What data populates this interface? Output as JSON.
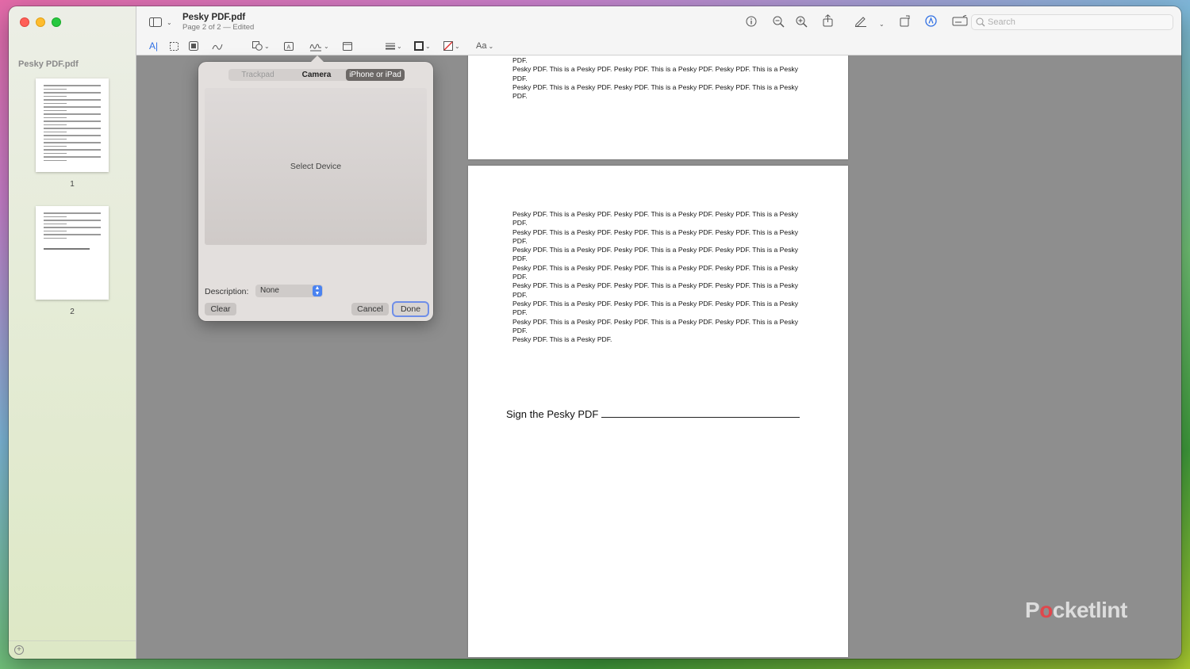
{
  "window": {
    "title": "Pesky PDF.pdf",
    "subtitle": "Page 2 of 2 — Edited"
  },
  "sidebar": {
    "title": "Pesky PDF.pdf",
    "pages": [
      {
        "label": "1"
      },
      {
        "label": "2"
      }
    ]
  },
  "toolbar": {
    "search_placeholder": "Search",
    "icons": [
      "sidebar-toggle-icon",
      "info-icon",
      "zoom-out-icon",
      "zoom-in-icon",
      "share-icon",
      "pen-icon",
      "rotate-icon",
      "markup-icon",
      "form-fill-icon"
    ],
    "markup_icons": [
      "text-select-icon",
      "rect-select-icon",
      "redact-icon",
      "sketch-icon",
      "shapes-icon",
      "text-box-icon",
      "signature-icon",
      "note-icon",
      "line-style-icon",
      "border-color-icon",
      "fill-color-icon"
    ],
    "font_label": "Aa"
  },
  "document": {
    "page1_lines": [
      "PDF.",
      "Pesky PDF. This is a Pesky PDF. Pesky PDF. This is a Pesky PDF. Pesky PDF. This is a Pesky",
      "PDF.",
      "Pesky PDF. This is a Pesky PDF. Pesky PDF. This is a Pesky PDF. Pesky PDF. This is a Pesky",
      "PDF."
    ],
    "page2_lines": [
      "Pesky PDF. This is a Pesky PDF. Pesky PDF. This is a Pesky PDF. Pesky PDF. This is a Pesky",
      "PDF.",
      "Pesky PDF. This is a Pesky PDF. Pesky PDF. This is a Pesky PDF. Pesky PDF. This is a Pesky",
      "PDF.",
      "Pesky PDF. This is a Pesky PDF. Pesky PDF. This is a Pesky PDF. Pesky PDF. This is a Pesky",
      "PDF.",
      "Pesky PDF. This is a Pesky PDF. Pesky PDF. This is a Pesky PDF. Pesky PDF. This is a Pesky",
      "PDF.",
      "Pesky PDF. This is a Pesky PDF. Pesky PDF. This is a Pesky PDF. Pesky PDF. This is a Pesky",
      "PDF.",
      "Pesky PDF. This is a Pesky PDF. Pesky PDF. This is a Pesky PDF. Pesky PDF. This is a Pesky",
      "PDF.",
      "Pesky PDF. This is a Pesky PDF. Pesky PDF. This is a Pesky PDF. Pesky PDF. This is a Pesky",
      "PDF.",
      "Pesky PDF. This is a Pesky PDF."
    ],
    "signature_prompt": "Sign the Pesky PDF"
  },
  "signature_popover": {
    "tabs": [
      "Trackpad",
      "Camera",
      "iPhone or iPad"
    ],
    "active_tab": "iPhone or iPad",
    "area_text": "Select Device",
    "description_label": "Description:",
    "description_value": "None",
    "clear_label": "Clear",
    "cancel_label": "Cancel",
    "done_label": "Done"
  },
  "watermark": {
    "text_before": "P",
    "text_o": "o",
    "text_after": "cketlint"
  }
}
